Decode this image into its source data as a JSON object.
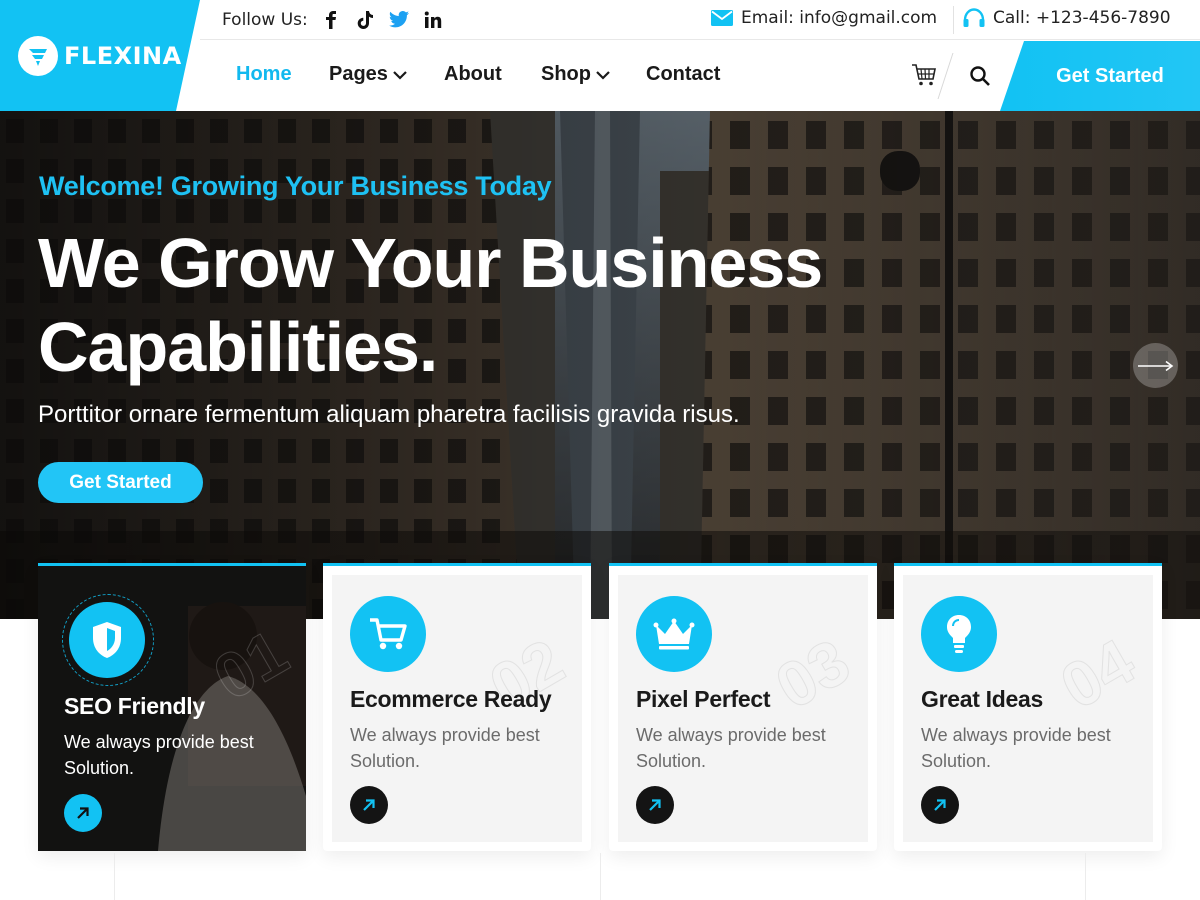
{
  "brand": {
    "name": "FLEXINA",
    "accent": "#12c2f3",
    "dark": "#141414"
  },
  "topbar": {
    "follow_label": "Follow Us:",
    "social_icons": [
      "facebook-icon",
      "tiktok-icon",
      "twitter-icon",
      "linkedin-icon"
    ],
    "email": "Email: info@gmail.com",
    "call": "Call: +123-456-7890"
  },
  "nav": {
    "items": [
      {
        "label": "Home",
        "active": true,
        "has_dropdown": false
      },
      {
        "label": "Pages",
        "active": false,
        "has_dropdown": true
      },
      {
        "label": "About",
        "active": false,
        "has_dropdown": false
      },
      {
        "label": "Shop",
        "active": false,
        "has_dropdown": true
      },
      {
        "label": "Contact",
        "active": false,
        "has_dropdown": false
      }
    ],
    "cta": "Get Started"
  },
  "hero": {
    "eyebrow": "Welcome! Growing Your Business Today",
    "title_line1": "We Grow Your Business",
    "title_line2": "Capabilities.",
    "subtitle": "Porttitor ornare fermentum aliquam pharetra facilisis gravida risus.",
    "button": "Get Started"
  },
  "features": [
    {
      "number": "01",
      "title": "SEO Friendly",
      "text": "We always provide best Solution.",
      "icon": "shield-icon",
      "highlighted": true
    },
    {
      "number": "02",
      "title": "Ecommerce Ready",
      "text": "We always provide best Solution.",
      "icon": "cart-icon",
      "highlighted": false
    },
    {
      "number": "03",
      "title": "Pixel Perfect",
      "text": "We always provide best Solution.",
      "icon": "crown-icon",
      "highlighted": false
    },
    {
      "number": "04",
      "title": "Great Ideas",
      "text": "We always provide best Solution.",
      "icon": "lightbulb-icon",
      "highlighted": false
    }
  ]
}
